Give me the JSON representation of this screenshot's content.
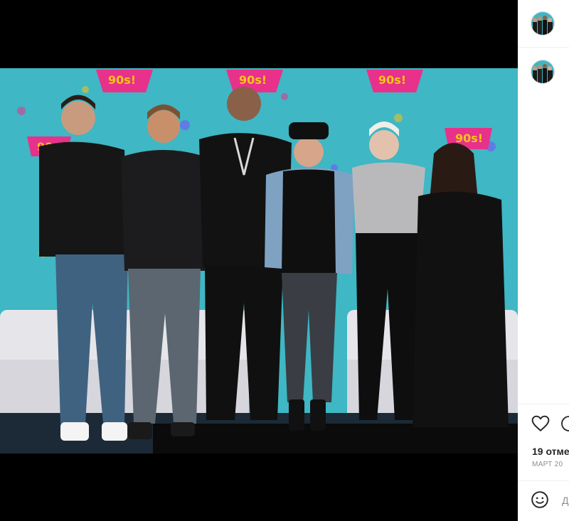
{
  "post": {
    "photo_description_icon": "group-photo",
    "banner_text": "90s!",
    "likes_text": "19 отме",
    "date_text": "МАРТ 20",
    "comment_placeholder": "Д"
  },
  "icons": {
    "like": "heart-icon",
    "comment": "comment-icon",
    "emoji": "smiley-icon"
  },
  "colors": {
    "backdrop": "#3fb7c4",
    "accent_pink": "#e8318a",
    "accent_yellow": "#f5c518",
    "panel_bg": "#ffffff",
    "text_primary": "#262626",
    "text_secondary": "#8e8e8e"
  }
}
